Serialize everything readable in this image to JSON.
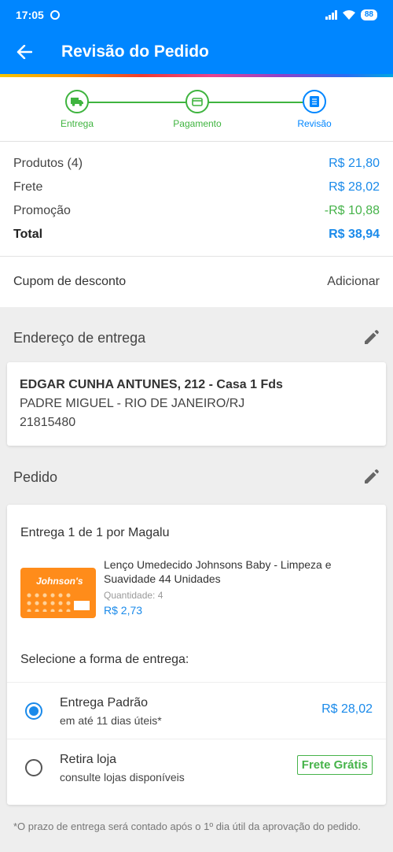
{
  "status_bar": {
    "time": "17:05",
    "battery": "88"
  },
  "app_bar": {
    "title": "Revisão do Pedido",
    "back_icon": "arrow-left-icon"
  },
  "stepper": {
    "steps": [
      {
        "label": "Entrega",
        "icon": "truck-icon",
        "state": "done"
      },
      {
        "label": "Pagamento",
        "icon": "credit-card-icon",
        "state": "done"
      },
      {
        "label": "Revisão",
        "icon": "document-icon",
        "state": "current"
      }
    ]
  },
  "summary": {
    "products_label": "Produtos (4)",
    "products_value": "R$ 21,80",
    "shipping_label": "Frete",
    "shipping_value": "R$ 28,02",
    "promo_label": "Promoção",
    "promo_value": "-R$ 10,88",
    "total_label": "Total",
    "total_value": "R$ 38,94"
  },
  "coupon": {
    "label": "Cupom de desconto",
    "action": "Adicionar"
  },
  "address_section": {
    "title": "Endereço de entrega",
    "line1": "EDGAR CUNHA ANTUNES, 212 - Casa 1 Fds",
    "line2": "PADRE MIGUEL - RIO DE JANEIRO/RJ",
    "line3": "21815480"
  },
  "order_section": {
    "title": "Pedido",
    "shipment_title": "Entrega 1 de 1 por Magalu",
    "product": {
      "name": "Lenço Umedecido Johnsons Baby - Limpeza e Suavidade 44 Unidades",
      "brand": "Johnson's",
      "quantity_label": "Quantidade:  4",
      "price": "R$ 2,73"
    },
    "select_title": "Selecione a forma de entrega:",
    "options": [
      {
        "name": "Entrega Padrão",
        "sub": "em até 11 dias úteis*",
        "price": "R$ 28,02",
        "selected": true
      },
      {
        "name": "Retira loja",
        "sub": "consulte lojas disponíveis",
        "badge": "Frete Grátis",
        "selected": false
      }
    ]
  },
  "footnote": "*O prazo de entrega será contado após o 1º dia útil da aprovação do pedido.",
  "colors": {
    "primary": "#0086ff",
    "green": "#3fb43f",
    "price_blue": "#1a8aea"
  }
}
